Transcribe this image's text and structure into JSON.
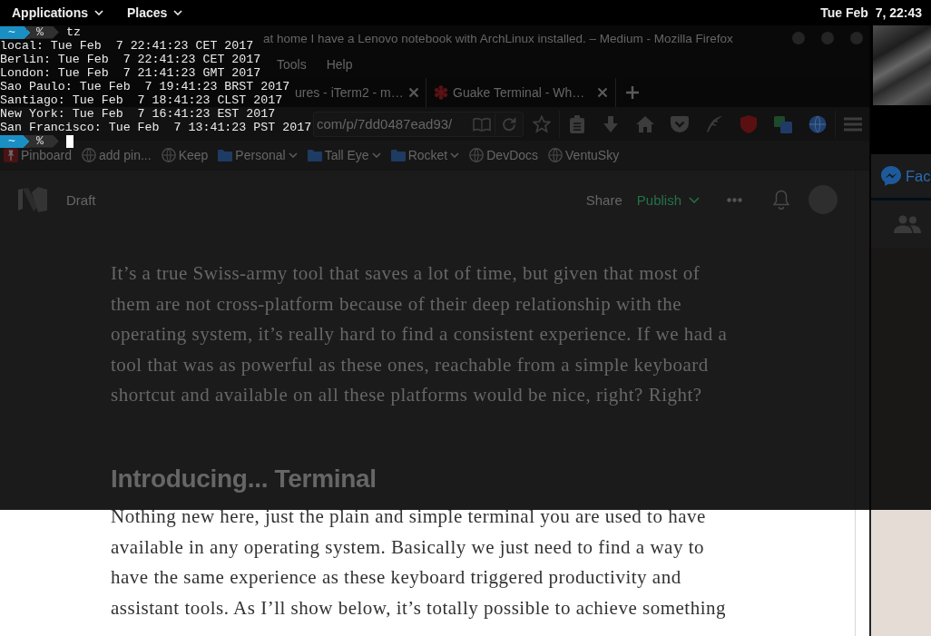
{
  "top_bar": {
    "menus": [
      {
        "label": "Applications"
      },
      {
        "label": "Places"
      }
    ],
    "clock": "Tue Feb  7, 22:43"
  },
  "terminal": {
    "lines": [
      {
        "kind": "prompt",
        "dir": "~",
        "symbol": "%",
        "command": "tz",
        "cursor": false
      },
      {
        "kind": "output",
        "text": "local: Tue Feb  7 22:41:23 CET 2017"
      },
      {
        "kind": "output",
        "text": "Berlin: Tue Feb  7 22:41:23 CET 2017"
      },
      {
        "kind": "output",
        "text": "London: Tue Feb  7 21:41:23 GMT 2017"
      },
      {
        "kind": "output",
        "text": "Sao Paulo: Tue Feb  7 19:41:23 BRST 2017"
      },
      {
        "kind": "output",
        "text": "Santiago: Tue Feb  7 18:41:23 CLST 2017"
      },
      {
        "kind": "output",
        "text": "New York: Tue Feb  7 16:41:23 EST 2017"
      },
      {
        "kind": "output",
        "text": "San Francisco: Tue Feb  7 13:41:23 PST 2017"
      },
      {
        "kind": "prompt",
        "dir": "~",
        "symbol": "%",
        "cursor": true
      }
    ]
  },
  "browser": {
    "title": "at home I have a Lenovo notebook with ArchLinux installed. – Medium - Mozilla Firefox",
    "menu": [
      {
        "label": "Tools"
      },
      {
        "label": "Help"
      }
    ],
    "tabs": [
      {
        "title": "ures - iTerm2 - m…",
        "favicon": false,
        "selected": false
      },
      {
        "title": "Guake Terminal - Wh…",
        "favicon": true,
        "selected": false
      }
    ],
    "url": "com/p/7dd0487ead93/",
    "bookmarks": [
      {
        "label": "Pinboard",
        "kind": "pin"
      },
      {
        "label": "add pin...",
        "kind": "site"
      },
      {
        "label": "Keep",
        "kind": "site"
      },
      {
        "label": "Personal",
        "kind": "folder"
      },
      {
        "label": "Tall Eye",
        "kind": "folder"
      },
      {
        "label": "Rocket",
        "kind": "folder"
      },
      {
        "label": "DevDocs",
        "kind": "site"
      },
      {
        "label": "VentuSky",
        "kind": "site"
      }
    ],
    "page": {
      "status": "Draft",
      "share": "Share",
      "publish": "Publish",
      "article": [
        {
          "kind": "paragraph",
          "text": "It’s a true Swiss-army tool that saves a lot of time, but given that most of them are not cross-platform because of their deep relationship with the operating system, it’s really hard to find a consistent experience. If we had a tool that was as powerful as these ones, reachable from a simple keyboard shortcut and available on all these platforms would be nice, right? Right?"
        },
        {
          "kind": "heading",
          "text": "Introducing... Terminal"
        },
        {
          "kind": "paragraph",
          "text": "Nothing new here, just the plain and simple terminal you are used to have available in any operating system. Basically we just need to find a way to have the same experience as these keyboard triggered productivity and assistant tools. As I’ll show below, it’s totally possible to achieve something"
        }
      ]
    }
  },
  "side_app": {
    "title": "Fac"
  }
}
